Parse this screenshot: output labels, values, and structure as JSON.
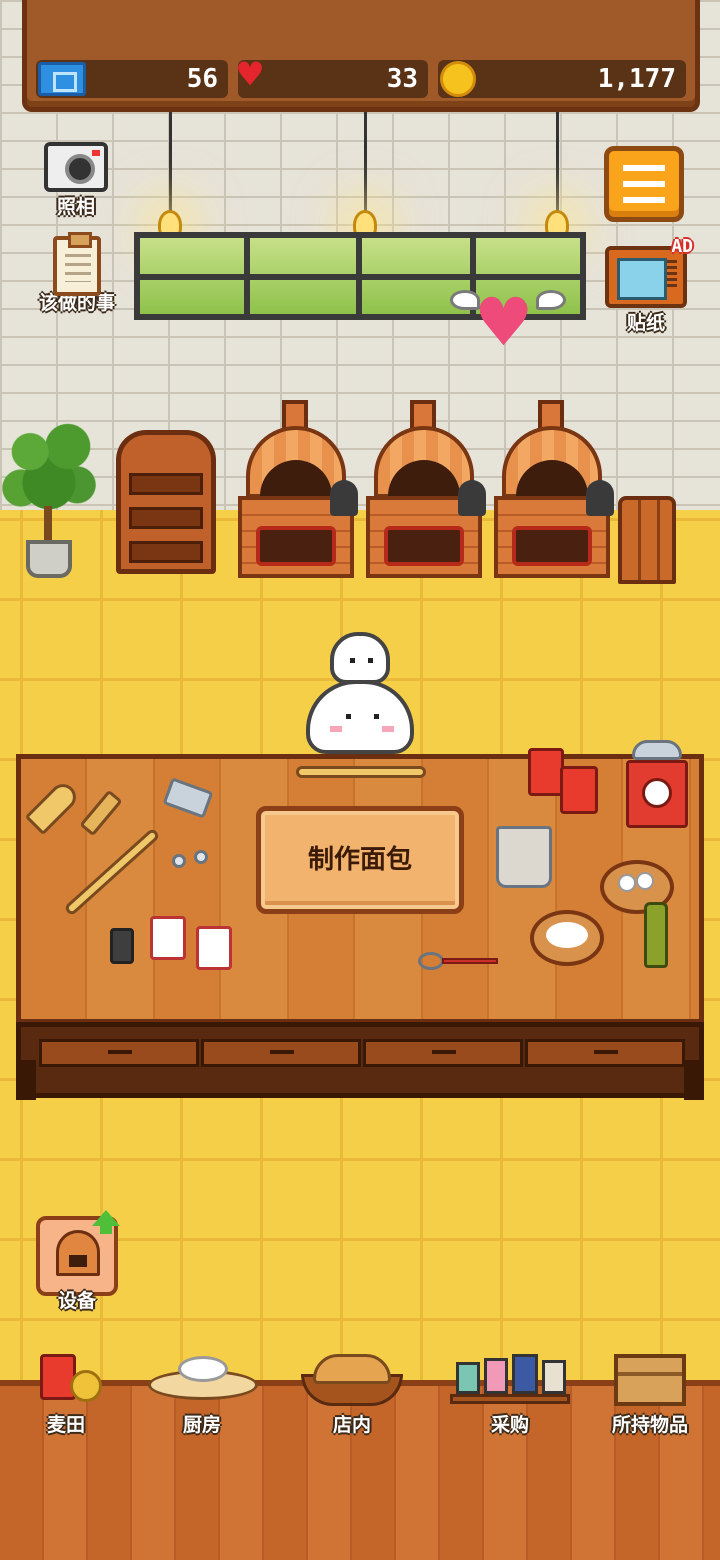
{
  "stats": {
    "tickets": "56",
    "hearts": "33",
    "coins": "1,177"
  },
  "side": {
    "camera_label": "照相",
    "todo_label": "该做的事",
    "sticker_label": "贴纸",
    "ad_badge": "AD",
    "equipment_label": "设备"
  },
  "counter": {
    "make_bread_label": "制作面包"
  },
  "nav": {
    "wheat_field": "麦田",
    "kitchen": "厨房",
    "store": "店内",
    "purchase": "采购",
    "inventory": "所持物品"
  },
  "icons": [
    "ticket-icon",
    "heart-icon",
    "coin-icon",
    "camera-icon",
    "clipboard-icon",
    "menu-icon",
    "tv-icon",
    "winged-heart-icon",
    "oven-icon",
    "up-arrow-icon"
  ],
  "colors": {
    "floor": "#f6cf48",
    "accent_orange": "#f9a41b",
    "wood": "#d47f35",
    "heart": "#e4252d"
  }
}
